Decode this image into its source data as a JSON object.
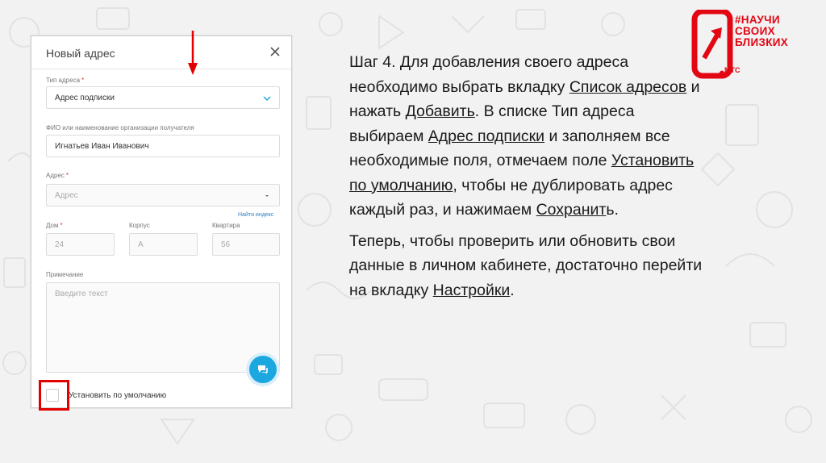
{
  "dialog": {
    "title": "Новый адрес",
    "close_icon": "close-icon",
    "address_type": {
      "label": "Тип адреса",
      "required": "*",
      "value": "Адрес подписки"
    },
    "recipient": {
      "label": "ФИО или наименование организации получателя",
      "value": "Игнатьев Иван Иванович"
    },
    "address": {
      "label": "Адрес",
      "required": "*",
      "placeholder": "Адрес"
    },
    "find_index_link": "Найти индекс",
    "house": {
      "label": "Дом",
      "required": "*",
      "placeholder": "24"
    },
    "building": {
      "label": "Корпус",
      "placeholder": "А"
    },
    "apartment": {
      "label": "Квартира",
      "placeholder": "56"
    },
    "note": {
      "label": "Примечание",
      "placeholder": "Введите текст"
    },
    "default_checkbox_label": "Установить по умолчанию",
    "chat_icon": "chat-icon"
  },
  "instructions": {
    "p1": [
      "Шаг 4. Для добавления своего адреса необходимо выбрать вкладку ",
      "Список адресов",
      " и нажать ",
      "Добавить",
      ". В списке Тип адреса выбираем ",
      "Адрес подписки",
      " и заполняем все необходимые поля, отмечаем поле ",
      "Установить по умолчанию",
      ", чтобы не дублировать адрес каждый раз, и нажимаем ",
      "Сохранит",
      "ь."
    ],
    "p2": [
      "Теперь, чтобы проверить или обновить свои данные в личном кабинете, достаточно перейти на вкладку ",
      "Настройки",
      "."
    ]
  },
  "logo": {
    "line1": "#НАУЧИ",
    "line2": "СВОИХ",
    "line3": "БЛИЗКИХ",
    "brand": "МТС"
  },
  "colors": {
    "accent_red": "#e10000",
    "brand_red": "#e30613",
    "chat_blue": "#1ba8e0",
    "link_blue": "#2a7fc4"
  }
}
